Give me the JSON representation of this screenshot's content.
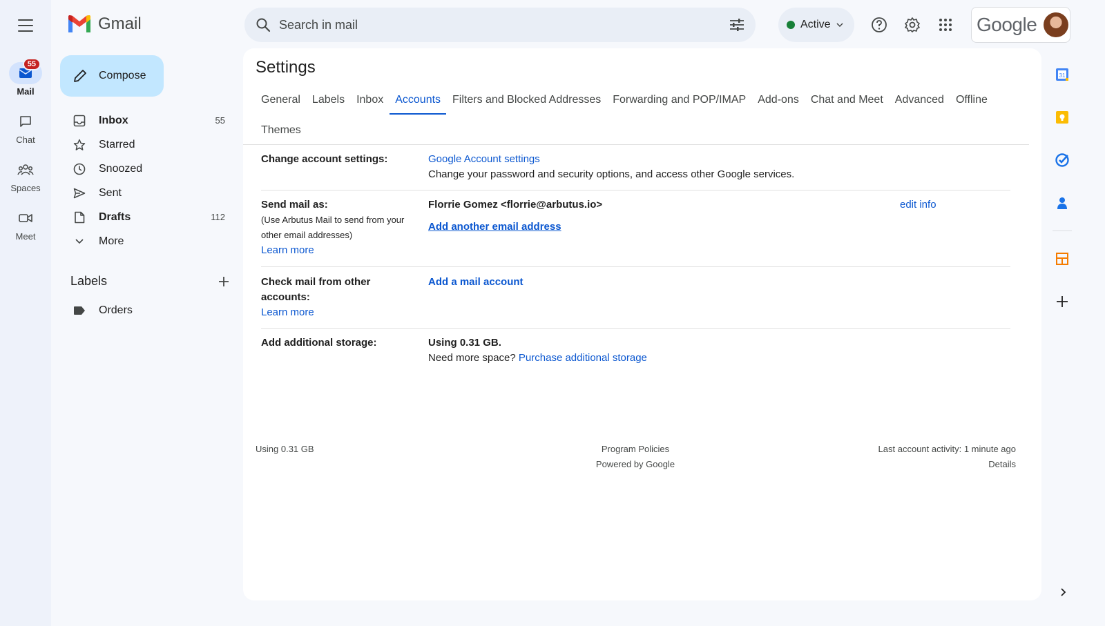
{
  "app": {
    "name": "Gmail"
  },
  "rail": {
    "items": [
      {
        "label": "Mail",
        "badge": "55"
      },
      {
        "label": "Chat"
      },
      {
        "label": "Spaces"
      },
      {
        "label": "Meet"
      }
    ]
  },
  "search": {
    "placeholder": "Search in mail"
  },
  "status": {
    "label": "Active",
    "color": "#188038"
  },
  "account": {
    "brand": "Google"
  },
  "compose": {
    "label": "Compose"
  },
  "nav": {
    "items": [
      {
        "label": "Inbox",
        "count": "55",
        "icon": "inbox-icon"
      },
      {
        "label": "Starred",
        "count": "",
        "icon": "star-icon"
      },
      {
        "label": "Snoozed",
        "count": "",
        "icon": "clock-icon"
      },
      {
        "label": "Sent",
        "count": "",
        "icon": "send-icon"
      },
      {
        "label": "Drafts",
        "count": "112",
        "icon": "draft-icon"
      },
      {
        "label": "More",
        "count": "",
        "icon": "chevron-down-icon"
      }
    ],
    "labels_title": "Labels",
    "labels": [
      {
        "label": "Orders"
      }
    ]
  },
  "settings": {
    "title": "Settings",
    "tabs": [
      "General",
      "Labels",
      "Inbox",
      "Accounts",
      "Filters and Blocked Addresses",
      "Forwarding and POP/IMAP",
      "Add-ons",
      "Chat and Meet",
      "Advanced",
      "Offline",
      "Themes"
    ],
    "active_tab": "Accounts",
    "rows": {
      "change_account": {
        "label": "Change account settings:",
        "link": "Google Account settings",
        "desc": "Change your password and security options, and access other Google services."
      },
      "send_as": {
        "label": "Send mail as:",
        "sub1": "(Use Arbutus Mail to send from your",
        "sub2": "other email addresses)",
        "learn_more": "Learn more",
        "identity": "Florrie Gomez <florrie@arbutus.io>",
        "add_address": "Add another email address",
        "edit": "edit info"
      },
      "check_mail": {
        "label1": "Check mail from other",
        "label2": "accounts:",
        "learn_more": "Learn more",
        "add_account": "Add a mail account"
      },
      "storage": {
        "label": "Add additional storage:",
        "using": "Using 0.31 GB.",
        "need_more": "Need more space?",
        "purchase": "Purchase additional storage"
      }
    },
    "footer": {
      "usage": "Using 0.31 GB",
      "policies": "Program Policies",
      "powered": "Powered by Google",
      "last_activity": "Last account activity: 1 minute ago",
      "details": "Details"
    }
  },
  "colors": {
    "accent": "#0b57d0",
    "compose_bg": "#c2e7ff",
    "badge": "#c5221f"
  }
}
